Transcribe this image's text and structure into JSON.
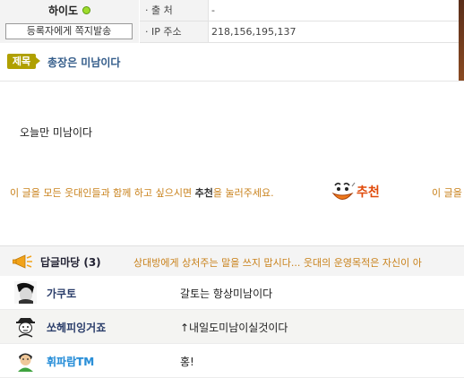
{
  "header": {
    "author": "하이도",
    "message_button": "등록자에게 쪽지발송",
    "source_label": "· 출 처",
    "source_value": "-",
    "ip_label": "· IP 주소",
    "ip_value": "218,156,195,137"
  },
  "subject": {
    "badge": "제목",
    "title": "총장은 미남이다"
  },
  "post": {
    "body": "오늘만 미남이다"
  },
  "recommend": {
    "prompt_before": "이 글을 모든 웃대인들과 함께 하고 싶으시면 ",
    "prompt_bold": "추천",
    "prompt_after": "을 눌러주세요.",
    "button_label": "추천",
    "repeat_text": "이 글을"
  },
  "comments": {
    "title": "답글마당 (3)",
    "notice": "상대방에게 상처주는 말을 쓰지 맙시다... 웃대의 운영목적은 자신이 아",
    "items": [
      {
        "nick": "가쿠토",
        "text": "갈토는 항상미남이다"
      },
      {
        "nick": "쏘헤피잉거죠",
        "text": "↑내일도미남이실것이다"
      },
      {
        "nick": "휘파람TM",
        "text": "홍!"
      }
    ]
  },
  "colors": {
    "accent_orange": "#c9821c",
    "subject_blue": "#335c8a",
    "badge_olive": "#b0a000",
    "online_green": "#9fdc2c"
  }
}
